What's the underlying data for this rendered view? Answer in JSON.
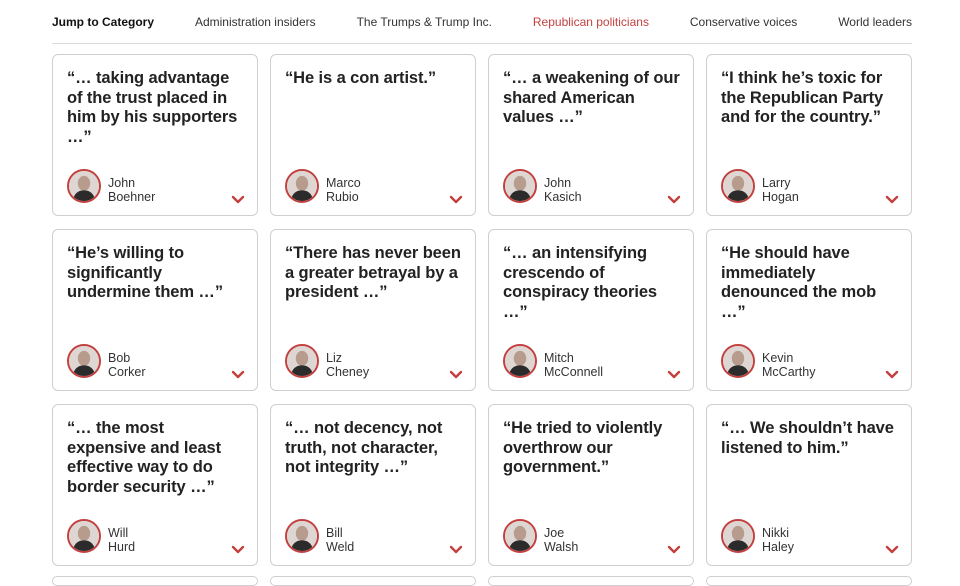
{
  "nav": {
    "jump_label": "Jump to Category",
    "items": [
      {
        "label": "Administration insiders",
        "active": false
      },
      {
        "label": "The Trumps & Trump Inc.",
        "active": false
      },
      {
        "label": "Republican politicians",
        "active": true
      },
      {
        "label": "Conservative voices",
        "active": false
      },
      {
        "label": "World leaders",
        "active": false
      }
    ]
  },
  "colors": {
    "accent": "#c4403f",
    "border": "#cfcfcf"
  },
  "cards": [
    {
      "quote": "“… taking advantage of the trust placed in him by his supporters …”",
      "first": "John",
      "last": "Boehner"
    },
    {
      "quote": "“He is a con artist.”",
      "first": "Marco",
      "last": "Rubio"
    },
    {
      "quote": "“… a weakening of our shared American values …”",
      "first": "John",
      "last": "Kasich"
    },
    {
      "quote": "“I think he’s toxic for the Republican Party and for the country.”",
      "first": "Larry",
      "last": "Hogan"
    },
    {
      "quote": "“He’s willing to significantly undermine them …”",
      "first": "Bob",
      "last": "Corker"
    },
    {
      "quote": "“There has never been a greater betrayal by a president …”",
      "first": "Liz",
      "last": "Cheney"
    },
    {
      "quote": "“… an intensifying crescendo of conspiracy theories …”",
      "first": "Mitch",
      "last": "McConnell"
    },
    {
      "quote": "“He should have immediately denounced the mob …”",
      "first": "Kevin",
      "last": "McCarthy"
    },
    {
      "quote": "“… the most expensive and least effective way to do border security …”",
      "first": "Will",
      "last": "Hurd"
    },
    {
      "quote": "“… not decency, not truth, not character, not integrity …”",
      "first": "Bill",
      "last": "Weld"
    },
    {
      "quote": "“He tried to violently overthrow our government.”",
      "first": "Joe",
      "last": "Walsh"
    },
    {
      "quote": "“… We shouldn’t have listened to him.”",
      "first": "Nikki",
      "last": "Haley"
    }
  ]
}
